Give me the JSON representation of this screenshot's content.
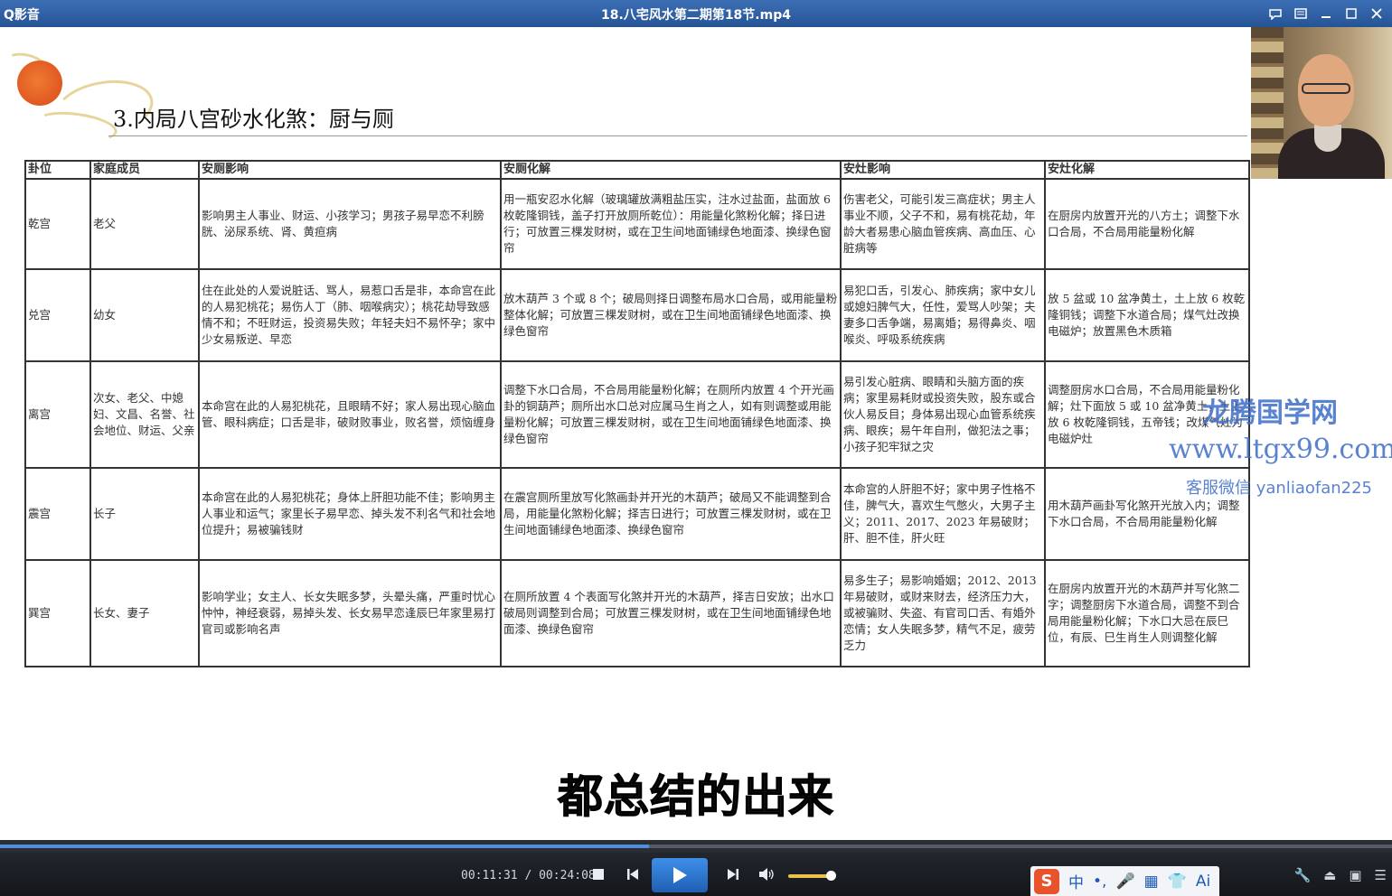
{
  "window": {
    "app_name": "Q影音",
    "file_title": "18.八宅风水第二期第18节.mp4"
  },
  "slide": {
    "title": "3.内局八宫砂水化煞：厨与厕",
    "table": {
      "headers": [
        "卦位",
        "家庭成员",
        "安厕影响",
        "安厕化解",
        "安灶影响",
        "安灶化解"
      ],
      "rows": [
        [
          "乾宫",
          "老父",
          "影响男主人事业、财运、小孩学习；男孩子易早恋不利膀胱、泌尿系统、肾、黄疸病",
          "用一瓶安忍水化解（玻璃罐放满粗盐压实，注水过盐面，盐面放 6 枚乾隆铜钱，盖子打开放厕所乾位）：用能量化煞粉化解；择日进行；可放置三棵发财树，或在卫生间地面铺绿色地面漆、换绿色窗帘",
          "伤害老父，可能引发三高症状；男主人事业不顺，父子不和，易有桃花劫，年龄大者易患心脑血管疾病、高血压、心脏病等",
          "在厨房内放置开光的八方土；调整下水口合局，不合局用能量粉化解"
        ],
        [
          "兑宫",
          "幼女",
          "住在此处的人爱说脏话、骂人，易惹口舌是非，本命宫在此的人易犯桃花；易伤人丁（肺、咽喉病灾）；桃花劫导致感情不和；不旺财运，投资易失败；年轻夫妇不易怀孕；家中少女易叛逆、早恋",
          "放木葫芦 3 个或 8 个；破局则择日调整布局水口合局，或用能量粉整体化解；可放置三棵发财树，或在卫生间地面铺绿色地面漆、换绿色窗帘",
          "易犯口舌，引发心、肺疾病；家中女儿或媳妇脾气大，任性，爱骂人吵架；夫妻多口舌争端，易离婚；易得鼻炎、咽喉炎、呼吸系统疾病",
          "放 5 盆或 10 盆净黄土，土上放 6 枚乾隆铜钱；调整下水道合局；煤气灶改换电磁炉；放置黑色木质箱"
        ],
        [
          "离宫",
          "次女、老父、中媳妇、文昌、名誉、社会地位、财运、父亲",
          "本命宫在此的人易犯桃花，且眼睛不好；家人易出现心脑血管、眼科病症；口舌是非，破财败事业，败名誉，烦恼缠身",
          "调整下水口合局，不合局用能量粉化解；在厕所内放置 4 个开光画卦的铜葫芦；厕所出水口总对应属马生肖之人，如有则调整或用能量粉化解；可放置三棵发财树，或在卫生间地面铺绿色地面漆、换绿色窗帘",
          "易引发心脏病、眼睛和头脑方面的疾病；家里易耗财或投资失败，股东或合伙人易反目；身体易出现心血管系统疾病、眼疾；易午年自刑，做犯法之事；小孩子犯牢狱之灾",
          "调整厨房水口合局，不合局用能量粉化解；灶下面放 5 或 10 盆净黄土，土上放 6 枚乾隆铜钱，五帝钱；改煤气灶为电磁炉灶"
        ],
        [
          "震宫",
          "长子",
          "本命宫在此的人易犯桃花；身体上肝胆功能不佳；影响男主人事业和运气；家里长子易早恋、掉头发不利名气和社会地位提升；易被骗钱财",
          "在震宫厕所里放写化煞画卦并开光的木葫芦；破局又不能调整到合局，用能量化煞粉化解；择吉日进行；可放置三棵发财树，或在卫生间地面铺绿色地面漆、换绿色窗帘",
          "本命宫的人肝胆不好；家中男子性格不佳，脾气大，喜欢生气憋火，大男子主义；2011、2017、2023 年易破财；肝、胆不佳，肝火旺",
          "用木葫芦画卦写化煞开光放入内；调整下水口合局，不合局用能量粉化解"
        ],
        [
          "巽宫",
          "长女、妻子",
          "影响学业；女主人、长女失眠多梦，头晕头痛，严重时忧心忡忡，神经衰弱，易掉头发、长女易早恋逢辰巳年家里易打官司或影响名声",
          "在厕所放置 4 个表面写化煞并开光的木葫芦，择吉日安放；出水口破局则调整到合局；可放置三棵发财树，或在卫生间地面铺绿色地面漆、换绿色窗帘",
          "易多生子；易影响婚姻；2012、2013 年易破财，或财来财去，经济压力大，或被骗财、失盗、有官司口舌、有婚外恋情；女人失眠多梦，精气不足，疲劳乏力",
          "在厨房内放置开光的木葫芦并写化煞二字；调整厨房下水道合局，调整不到合局用能量粉化解；下水口大忌在辰巳位，有辰、巳生肖生人则调整化解"
        ]
      ]
    }
  },
  "watermark": {
    "site_name": "龙腾国学网",
    "url": "www.ltgx99.com",
    "contact": "客服微信 yanliaofan225"
  },
  "subtitle": "都总结的出来",
  "player": {
    "current_time": "00:11:31",
    "total_time": "00:24:08",
    "time_separator": " / ",
    "progress": 0.466,
    "volume": 0.9
  },
  "ime": {
    "logo": "S",
    "items": [
      "中",
      "•,",
      "🎤",
      "▦",
      "👕",
      "Ai"
    ]
  },
  "colors": {
    "titlebar": "#2f62a8",
    "accent": "#3f8fe8",
    "watermark": "#3d6ec8"
  }
}
